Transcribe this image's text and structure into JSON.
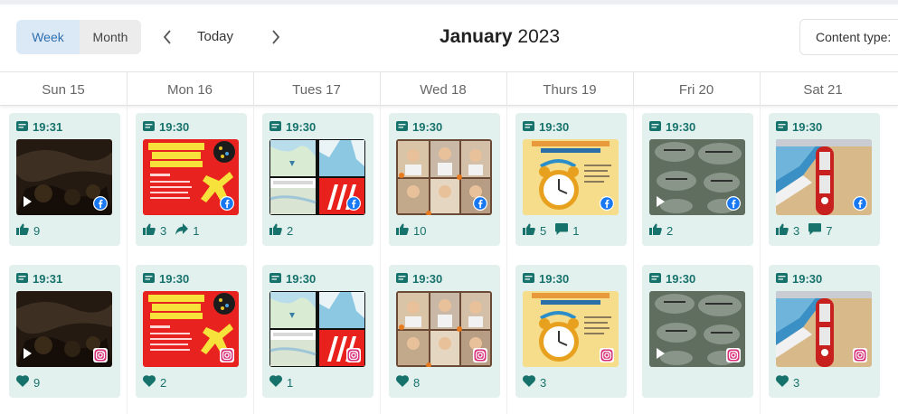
{
  "toolbar": {
    "week_label": "Week",
    "month_label": "Month",
    "prev_icon": "chevron-left-icon",
    "next_icon": "chevron-right-icon",
    "today_label": "Today",
    "title_month": "January",
    "title_year": "2023",
    "content_type_label": "Content type:"
  },
  "days": [
    "Sun 15",
    "Mon 16",
    "Tues 17",
    "Wed 18",
    "Thurs 19",
    "Fri 20",
    "Sat 21"
  ],
  "colors": {
    "accent": "#17726c",
    "card_bg": "#e3f1ee",
    "week_active_bg": "#dbe9f7",
    "week_active_text": "#2f6fb0"
  },
  "rows": [
    {
      "platform": "facebook",
      "posts": [
        {
          "time": "19:31",
          "video": true,
          "stats": [
            {
              "icon": "thumbs-up-icon",
              "value": "9"
            }
          ]
        },
        {
          "time": "19:30",
          "video": false,
          "stats": [
            {
              "icon": "thumbs-up-icon",
              "value": "3"
            },
            {
              "icon": "share-icon",
              "value": "1"
            }
          ]
        },
        {
          "time": "19:30",
          "video": false,
          "stats": [
            {
              "icon": "thumbs-up-icon",
              "value": "2"
            }
          ]
        },
        {
          "time": "19:30",
          "video": false,
          "stats": [
            {
              "icon": "thumbs-up-icon",
              "value": "10"
            }
          ]
        },
        {
          "time": "19:30",
          "video": false,
          "stats": [
            {
              "icon": "thumbs-up-icon",
              "value": "5"
            },
            {
              "icon": "comment-icon",
              "value": "1"
            }
          ]
        },
        {
          "time": "19:30",
          "video": true,
          "stats": [
            {
              "icon": "thumbs-up-icon",
              "value": "2"
            }
          ]
        },
        {
          "time": "19:30",
          "video": false,
          "stats": [
            {
              "icon": "thumbs-up-icon",
              "value": "3"
            },
            {
              "icon": "comment-icon",
              "value": "7"
            }
          ]
        }
      ]
    },
    {
      "platform": "instagram",
      "posts": [
        {
          "time": "19:31",
          "video": true,
          "stats": [
            {
              "icon": "heart-icon",
              "value": "9"
            }
          ]
        },
        {
          "time": "19:30",
          "video": false,
          "stats": [
            {
              "icon": "heart-icon",
              "value": "2"
            }
          ]
        },
        {
          "time": "19:30",
          "video": false,
          "stats": [
            {
              "icon": "heart-icon",
              "value": "1"
            }
          ]
        },
        {
          "time": "19:30",
          "video": false,
          "stats": [
            {
              "icon": "heart-icon",
              "value": "8"
            }
          ]
        },
        {
          "time": "19:30",
          "video": false,
          "stats": [
            {
              "icon": "heart-icon",
              "value": "3"
            }
          ]
        },
        {
          "time": "19:30",
          "video": true,
          "stats": []
        },
        {
          "time": "19:30",
          "video": false,
          "stats": [
            {
              "icon": "heart-icon",
              "value": "3"
            }
          ]
        }
      ]
    }
  ]
}
